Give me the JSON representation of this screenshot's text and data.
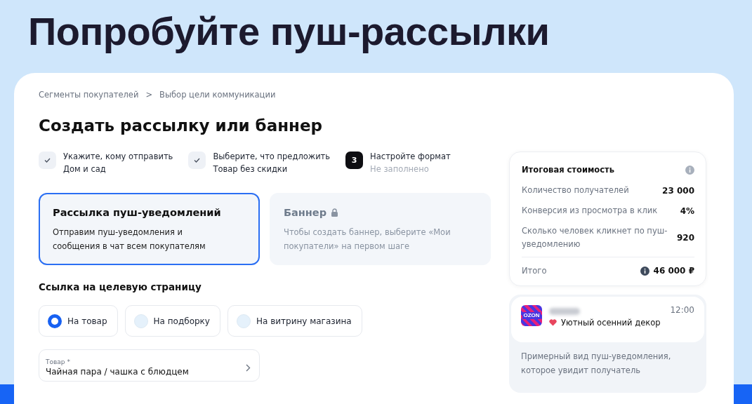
{
  "headline": "Попробуйте пуш-рассылки",
  "breadcrumbs": [
    "Сегменты покупателей",
    "Выбор цели коммуникации"
  ],
  "breadcrumb_separator": ">",
  "title": "Создать рассылку или баннер",
  "steps": [
    {
      "kind": "done",
      "label": "Укажите, кому отправить",
      "value": "Дом и сад"
    },
    {
      "kind": "done",
      "label": "Выберите, что предложить",
      "value": "Товар без скидки"
    },
    {
      "kind": "current",
      "number": "3",
      "label": "Настройте формат",
      "value": "Не заполнено"
    }
  ],
  "formats": [
    {
      "title": "Рассылка пуш-уведомлений",
      "description": "Отправим пуш-уведомления и сообщения в чат всем покупателям",
      "selected": true,
      "locked": false
    },
    {
      "title": "Баннер",
      "description": "Чтобы создать баннер, выберите «Мои покупатели» на первом шаге",
      "selected": false,
      "locked": true
    }
  ],
  "link_section": {
    "title": "Ссылка на целевую страницу",
    "options": [
      {
        "label": "На товар",
        "selected": true
      },
      {
        "label": "На подборку",
        "selected": false
      },
      {
        "label": "На витрину магазина",
        "selected": false
      }
    ],
    "product_field": {
      "label": "Товар *",
      "value": "Чайная пара / чашка с блюдцем"
    }
  },
  "cost": {
    "title": "Итоговая стоимость",
    "rows": [
      {
        "label": "Количество получателей",
        "value": "23 000"
      },
      {
        "label": "Конверсия из просмотра в клик",
        "value": "4%"
      },
      {
        "label": "Сколько человек кликнет по пуш-уведомлению",
        "value": "920"
      }
    ],
    "total_label": "Итого",
    "total_value": "46 000 ₽"
  },
  "preview": {
    "logo_text": "OZON",
    "time": "12:00",
    "message": "Уютный осенний декор",
    "caption": "Примерный вид пуш-уведомления, которое увидит получатель"
  }
}
